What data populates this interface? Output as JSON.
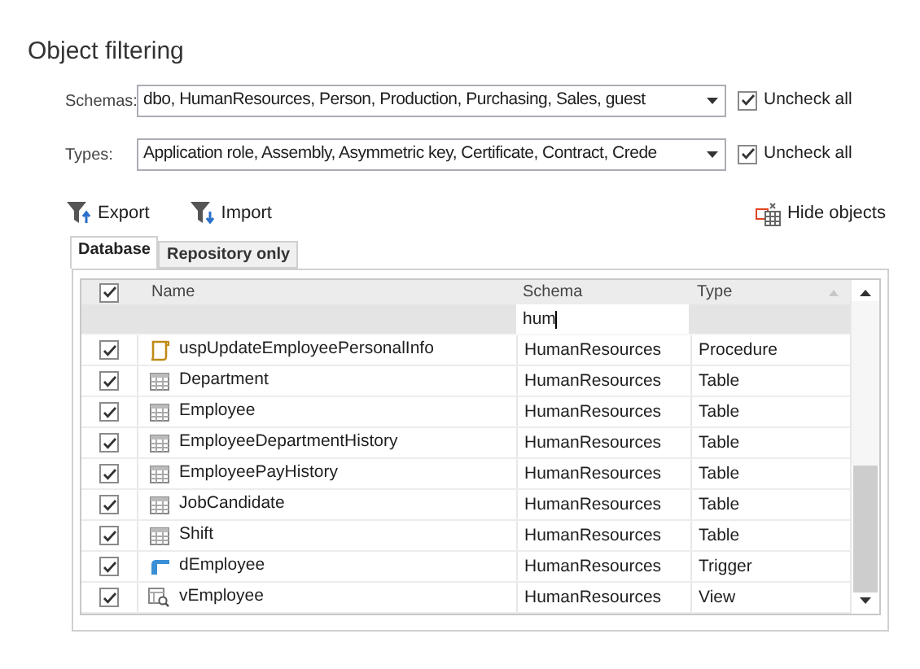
{
  "title": "Object filtering",
  "filters": [
    {
      "label": "Schemas:",
      "value": "dbo, HumanResources, Person, Production, Purchasing, Sales, guest",
      "uncheck_all": {
        "label": "Uncheck all",
        "checked": true
      }
    },
    {
      "label": "Types:",
      "value": "Application role, Assembly, Asymmetric key, Certificate, Contract, Crede",
      "uncheck_all": {
        "label": "Uncheck all",
        "checked": true
      }
    }
  ],
  "toolbar": {
    "export": "Export",
    "import": "Import",
    "hide_objects": "Hide objects"
  },
  "tabs": [
    {
      "label": "Database",
      "selected": true
    },
    {
      "label": "Repository only",
      "selected": false
    }
  ],
  "table": {
    "all_checked": true,
    "columns": [
      "Name",
      "Schema",
      "Type"
    ],
    "schema_filter": "hum",
    "rows": [
      {
        "checked": true,
        "kind": "procedure",
        "name": "uspUpdateEmployeePersonalInfo",
        "schema": "HumanResources",
        "type": "Procedure"
      },
      {
        "checked": true,
        "kind": "table",
        "name": "Department",
        "schema": "HumanResources",
        "type": "Table"
      },
      {
        "checked": true,
        "kind": "table",
        "name": "Employee",
        "schema": "HumanResources",
        "type": "Table"
      },
      {
        "checked": true,
        "kind": "table",
        "name": "EmployeeDepartmentHistory",
        "schema": "HumanResources",
        "type": "Table"
      },
      {
        "checked": true,
        "kind": "table",
        "name": "EmployeePayHistory",
        "schema": "HumanResources",
        "type": "Table"
      },
      {
        "checked": true,
        "kind": "table",
        "name": "JobCandidate",
        "schema": "HumanResources",
        "type": "Table"
      },
      {
        "checked": true,
        "kind": "table",
        "name": "Shift",
        "schema": "HumanResources",
        "type": "Table"
      },
      {
        "checked": true,
        "kind": "trigger",
        "name": "dEmployee",
        "schema": "HumanResources",
        "type": "Trigger"
      },
      {
        "checked": true,
        "kind": "view",
        "name": "vEmployee",
        "schema": "HumanResources",
        "type": "View"
      }
    ]
  }
}
